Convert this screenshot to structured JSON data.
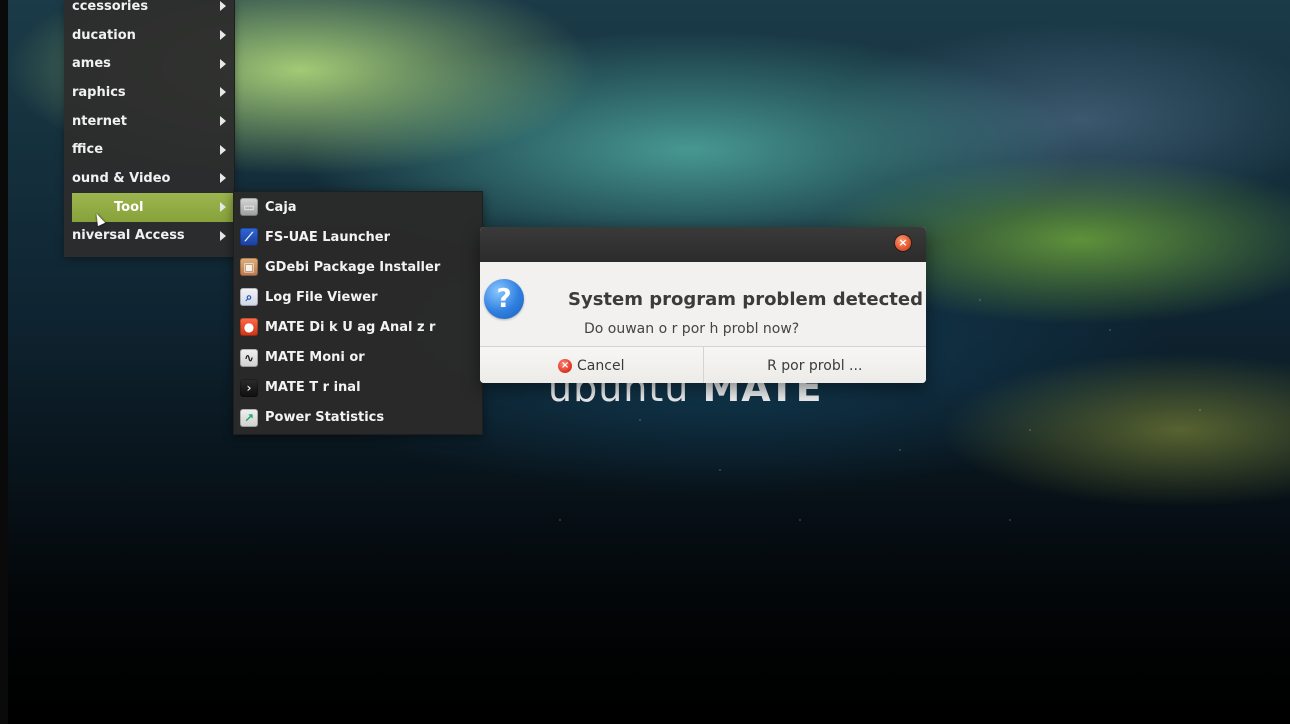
{
  "desktop": {
    "logo_left": "ubuntu",
    "logo_right": "MATE"
  },
  "menu": {
    "items": [
      {
        "label": "ccessories"
      },
      {
        "label": "ducation"
      },
      {
        "label": "ames"
      },
      {
        "label": "raphics"
      },
      {
        "label": "nternet"
      },
      {
        "label": "ffice"
      },
      {
        "label": "ound & Video"
      },
      {
        "label": "Tool"
      },
      {
        "label": "niversal Access"
      }
    ]
  },
  "submenu": {
    "items": [
      {
        "label": "Caja",
        "icon": "folder-icon"
      },
      {
        "label": "FS-UAE Launcher",
        "icon": "fs-uae-icon"
      },
      {
        "label": "GDebi Package Installer",
        "icon": "package-icon"
      },
      {
        "label": "Log File Viewer",
        "icon": "log-viewer-icon"
      },
      {
        "label": "MATE Di k U ag Anal z r",
        "icon": "disk-usage-icon"
      },
      {
        "label": "MATE Moni or",
        "icon": "system-monitor-icon"
      },
      {
        "label": "MATE T r inal",
        "icon": "terminal-icon"
      },
      {
        "label": "Power Statistics",
        "icon": "power-statistics-icon"
      }
    ]
  },
  "dialog": {
    "title": "System program problem detected",
    "message": "Do ouwan o r por h probl now?",
    "buttons": {
      "cancel": "Cancel",
      "report": "R por probl ..."
    },
    "close_icon": "close-icon",
    "question_icon": "question-icon"
  }
}
